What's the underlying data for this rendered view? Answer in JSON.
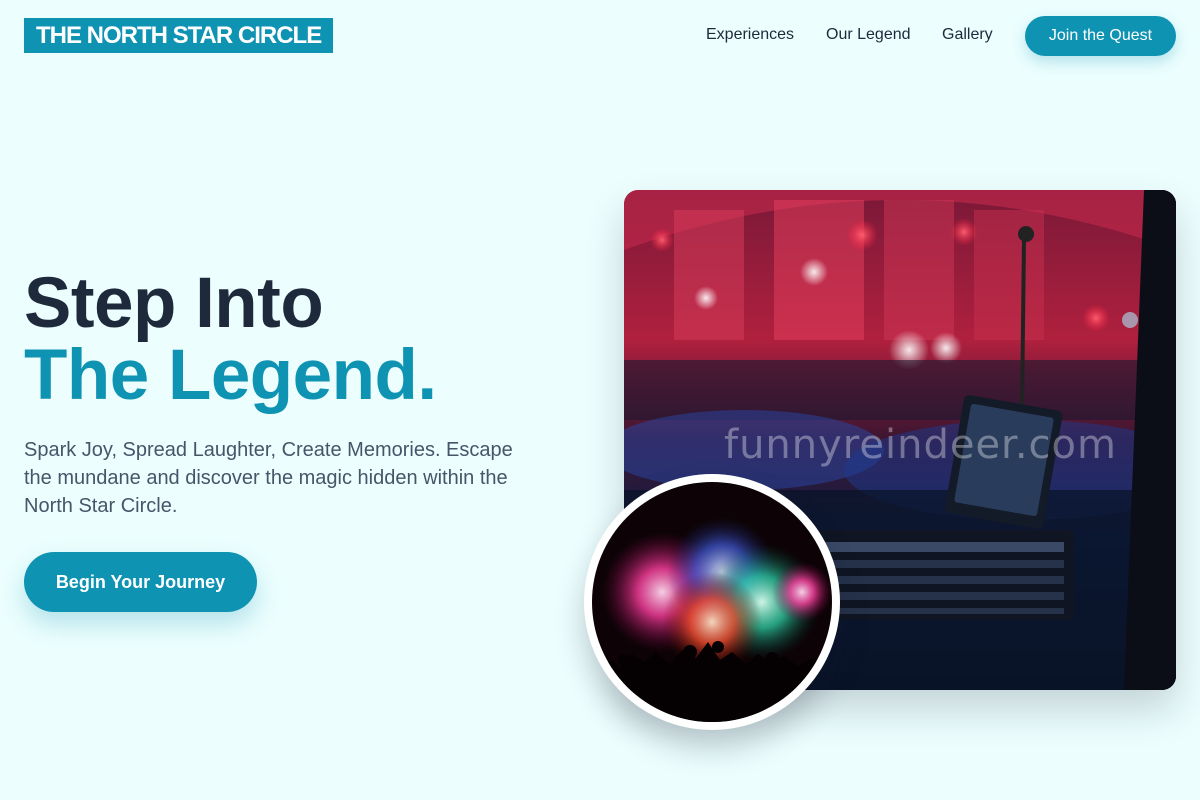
{
  "header": {
    "logo_text": "THE NORTH STAR CIRCLE",
    "nav": [
      {
        "label": "Experiences"
      },
      {
        "label": "Our Legend"
      },
      {
        "label": "Gallery"
      }
    ],
    "cta_label": "Join the Quest"
  },
  "hero": {
    "title_line1": "Step Into",
    "title_line2": "The Legend.",
    "subtitle": "Spark Joy, Spread Laughter, Create Memories. Escape the mundane and discover the magic hidden within the North Star Circle.",
    "button_label": "Begin Your Journey"
  },
  "media": {
    "main_image": "concert-stage-photo",
    "watermark": "funnyreindeer.com",
    "inset_image": "fireworks-crowd-photo"
  },
  "colors": {
    "background": "#ecfefe",
    "accent": "#0e93b3",
    "heading": "#1e293b",
    "body_text": "#475569"
  }
}
